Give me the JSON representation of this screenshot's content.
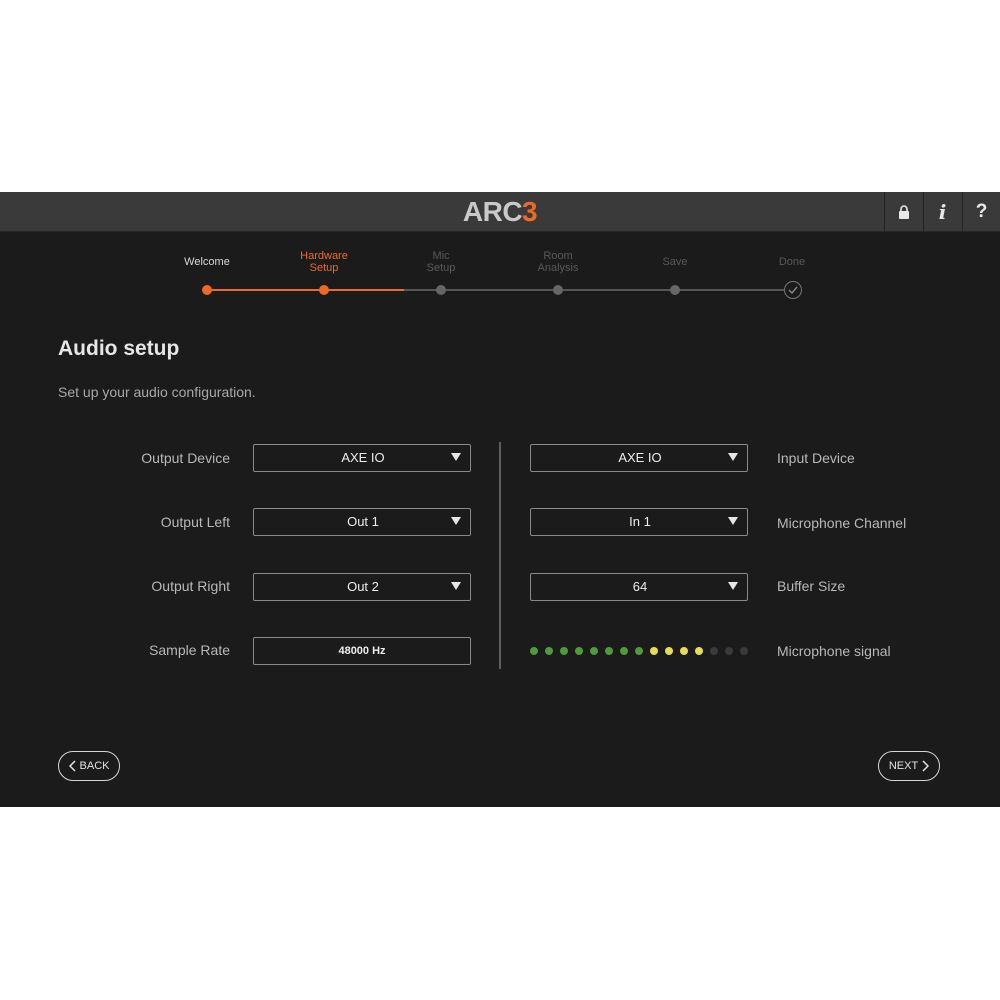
{
  "app": {
    "logo_text": "ARC",
    "logo_num": "3",
    "accent": "#ee6a24"
  },
  "titlebar": {
    "icons": [
      "lock-icon",
      "info-icon",
      "help-icon"
    ],
    "info_glyph": "i",
    "help_glyph": "?"
  },
  "steps": [
    {
      "line1": "Welcome",
      "line2": "",
      "state": "done"
    },
    {
      "line1": "Hardware",
      "line2": "Setup",
      "state": "active"
    },
    {
      "line1": "Mic",
      "line2": "Setup",
      "state": "pending"
    },
    {
      "line1": "Room",
      "line2": "Analysis",
      "state": "pending"
    },
    {
      "line1": "Save",
      "line2": "",
      "state": "pending"
    },
    {
      "line1": "Done",
      "line2": "",
      "state": "pending"
    }
  ],
  "page": {
    "title": "Audio setup",
    "subtitle": "Set up your audio configuration."
  },
  "left": {
    "output_device": {
      "label": "Output Device",
      "value": "AXE IO"
    },
    "output_left": {
      "label": "Output Left",
      "value": "Out 1"
    },
    "output_right": {
      "label": "Output Right",
      "value": "Out 2"
    },
    "sample_rate": {
      "label": "Sample Rate",
      "value": "48000 Hz"
    }
  },
  "right": {
    "input_device": {
      "label": "Input Device",
      "value": "AXE IO"
    },
    "mic_channel": {
      "label": "Microphone Channel",
      "value": "In 1"
    },
    "buffer_size": {
      "label": "Buffer Size",
      "value": "64"
    },
    "mic_signal": {
      "label": "Microphone signal",
      "total_leds": 15,
      "green_leds": 8,
      "yellow_leds": 4
    }
  },
  "nav": {
    "back_label": "BACK",
    "next_label": "NEXT"
  },
  "colors": {
    "led_green": "#4f9a3a",
    "led_yellow": "#e6dd55",
    "led_off": "#3a3a3a"
  }
}
